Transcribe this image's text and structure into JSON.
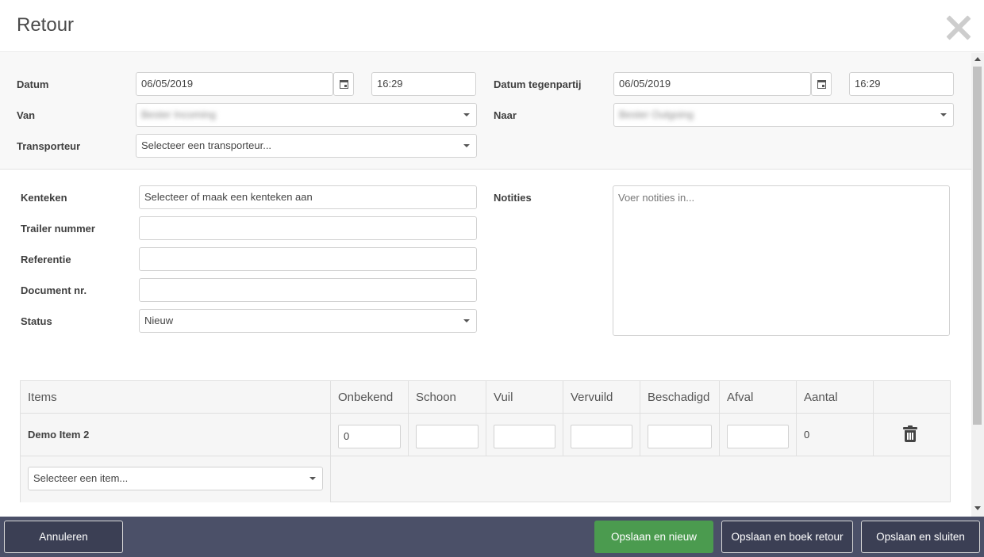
{
  "header": {
    "title": "Retour"
  },
  "top": {
    "datum_label": "Datum",
    "datum_value": "06/05/2019",
    "tijd_value": "16:29",
    "datum_tegenpartij_label": "Datum tegenpartij",
    "datum_tegenpartij_value": "06/05/2019",
    "tijd_tegenpartij_value": "16:29",
    "van_label": "Van",
    "van_value": "Bester Incoming",
    "naar_label": "Naar",
    "naar_value": "Bester Outgoing",
    "transporteur_label": "Transporteur",
    "transporteur_placeholder": "Selecteer een transporteur..."
  },
  "details": {
    "kenteken_label": "Kenteken",
    "kenteken_placeholder": "Selecteer of maak een kenteken aan",
    "trailer_label": "Trailer nummer",
    "referentie_label": "Referentie",
    "document_label": "Document nr.",
    "status_label": "Status",
    "status_value": "Nieuw",
    "notities_label": "Notities",
    "notities_placeholder": "Voer notities in..."
  },
  "items_table": {
    "columns": [
      "Items",
      "Onbekend",
      "Schoon",
      "Vuil",
      "Vervuild",
      "Beschadigd",
      "Afval",
      "Aantal"
    ],
    "rows": [
      {
        "name": "Demo Item 2",
        "onbekend": "0",
        "aantal": "0"
      }
    ],
    "add_item_placeholder": "Selecteer een item..."
  },
  "footer": {
    "cancel_label": "Annuleren",
    "save_new_label": "Opslaan en nieuw",
    "save_book_label": "Opslaan en boek retour",
    "save_close_label": "Opslaan en sluiten"
  },
  "colors": {
    "footer_bg": "#4b5068",
    "button_dark": "#3b3f54",
    "button_green": "#4b9b4f"
  }
}
